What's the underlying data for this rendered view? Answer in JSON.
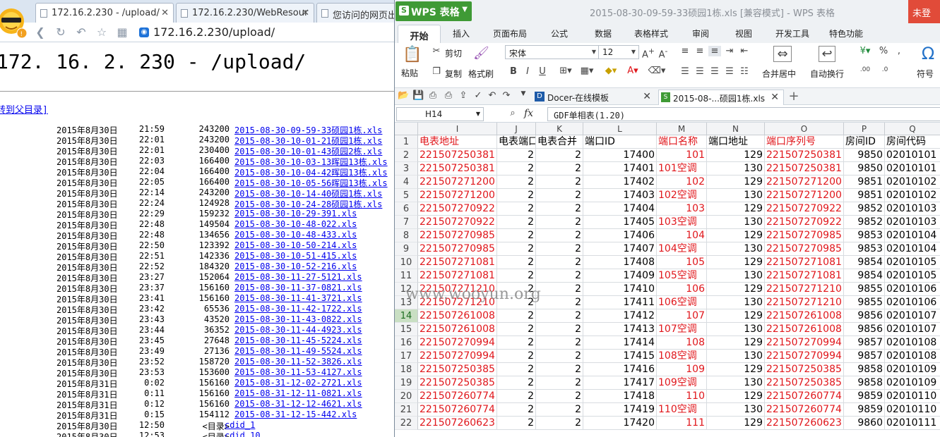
{
  "browser": {
    "tabs": [
      {
        "label": "172.16.2.230 - /upload/",
        "close": "✕"
      },
      {
        "label": "172.16.2.230/WebResour",
        "close": "✕"
      },
      {
        "label": "您访问的网页出"
      }
    ],
    "url": "172.16.2.230/upload/",
    "page_title": "172. 16. 2. 230 - /upload/",
    "parent_link": "转到父目录]",
    "files": [
      {
        "date": "2015年8月30日",
        "time": "21:59",
        "size": "243200",
        "name": "2015-08-30-09-59-33硕园1栋.xls"
      },
      {
        "date": "2015年8月30日",
        "time": "22:01",
        "size": "243200",
        "name": "2015-08-30-10-01-21硕园1栋.xls"
      },
      {
        "date": "2015年8月30日",
        "time": "22:01",
        "size": "230400",
        "name": "2015-08-30-10-01-43硕园2栋.xls"
      },
      {
        "date": "2015年8月30日",
        "time": "22:03",
        "size": "166400",
        "name": "2015-08-30-10-03-13晖园13栋.xls"
      },
      {
        "date": "2015年8月30日",
        "time": "22:04",
        "size": "166400",
        "name": "2015-08-30-10-04-42晖园13栋.xls"
      },
      {
        "date": "2015年8月30日",
        "time": "22:05",
        "size": "166400",
        "name": "2015-08-30-10-05-56晖园13栋.xls"
      },
      {
        "date": "2015年8月30日",
        "time": "22:14",
        "size": "243200",
        "name": "2015-08-30-10-14-40硕园1栋.xls"
      },
      {
        "date": "2015年8月30日",
        "time": "22:24",
        "size": "124928",
        "name": "2015-08-30-10-24-28硕园1栋.xls"
      },
      {
        "date": "2015年8月30日",
        "time": "22:29",
        "size": "159232",
        "name": "2015-08-30-10-29-391.xls"
      },
      {
        "date": "2015年8月30日",
        "time": "22:48",
        "size": "149504",
        "name": "2015-08-30-10-48-022.xls"
      },
      {
        "date": "2015年8月30日",
        "time": "22:48",
        "size": "134656",
        "name": "2015-08-30-10-48-433.xls"
      },
      {
        "date": "2015年8月30日",
        "time": "22:50",
        "size": "123392",
        "name": "2015-08-30-10-50-214.xls"
      },
      {
        "date": "2015年8月30日",
        "time": "22:51",
        "size": "142336",
        "name": "2015-08-30-10-51-415.xls"
      },
      {
        "date": "2015年8月30日",
        "time": "22:52",
        "size": "184320",
        "name": "2015-08-30-10-52-216.xls"
      },
      {
        "date": "2015年8月30日",
        "time": "23:27",
        "size": "152064",
        "name": "2015-08-30-11-27-5121.xls"
      },
      {
        "date": "2015年8月30日",
        "time": "23:37",
        "size": "156160",
        "name": "2015-08-30-11-37-0821.xls"
      },
      {
        "date": "2015年8月30日",
        "time": "23:41",
        "size": "156160",
        "name": "2015-08-30-11-41-3721.xls"
      },
      {
        "date": "2015年8月30日",
        "time": "23:42",
        "size": "65536",
        "name": "2015-08-30-11-42-1722.xls"
      },
      {
        "date": "2015年8月30日",
        "time": "23:43",
        "size": "43520",
        "name": "2015-08-30-11-43-0822.xls"
      },
      {
        "date": "2015年8月30日",
        "time": "23:44",
        "size": "36352",
        "name": "2015-08-30-11-44-4923.xls"
      },
      {
        "date": "2015年8月30日",
        "time": "23:45",
        "size": "27648",
        "name": "2015-08-30-11-45-5224.xls"
      },
      {
        "date": "2015年8月30日",
        "time": "23:49",
        "size": "27136",
        "name": "2015-08-30-11-49-5524.xls"
      },
      {
        "date": "2015年8月30日",
        "time": "23:52",
        "size": "158720",
        "name": "2015-08-30-11-52-3826.xls"
      },
      {
        "date": "2015年8月30日",
        "time": "23:53",
        "size": "153600",
        "name": "2015-08-30-11-53-4127.xls"
      },
      {
        "date": "2015年8月31日",
        "time": "0:02",
        "size": "156160",
        "name": "2015-08-31-12-02-2721.xls"
      },
      {
        "date": "2015年8月31日",
        "time": "0:11",
        "size": "156160",
        "name": "2015-08-31-12-11-0821.xls"
      },
      {
        "date": "2015年8月31日",
        "time": "0:12",
        "size": "156160",
        "name": "2015-08-31-12-12-4621.xls"
      },
      {
        "date": "2015年8月31日",
        "time": "0:15",
        "size": "154112",
        "name": "2015-08-31-12-15-442.xls"
      },
      {
        "date": "2015年8月30日",
        "time": "12:50",
        "size": "<目录>",
        "name": "cdid_1",
        "dir": true
      },
      {
        "date": "2015年8月30日",
        "time": "12:53",
        "size": "<目录>",
        "name": "cdid_10",
        "dir": true
      }
    ]
  },
  "wps": {
    "app_button": "WPS 表格",
    "doc_title": "2015-08-30-09-59-33硕园1栋.xls [兼容模式] - WPS 表格",
    "login": "未登",
    "menus": [
      "开始",
      "插入",
      "页面布局",
      "公式",
      "数据",
      "表格样式",
      "审阅",
      "视图",
      "开发工具",
      "特色功能"
    ],
    "ribbon": {
      "paste": "粘贴",
      "cut": "剪切",
      "copy": "复制",
      "format_painter": "格式刷",
      "font": "宋体",
      "font_size": "12",
      "merge_center": "合并居中",
      "auto_wrap": "自动换行",
      "symbol": "符号",
      "bold": "B",
      "italic": "I",
      "underline": "U"
    },
    "doc_tabs": [
      {
        "label": "Docer-在线模板",
        "close": "✕"
      },
      {
        "label": "2015-08-...硕园1栋.xls",
        "close": "✕"
      }
    ],
    "name_box": "H14",
    "fx": "fx",
    "formula": "GDF单相表(1.20)",
    "columns": [
      "I",
      "J",
      "K",
      "L",
      "M",
      "N",
      "O",
      "P",
      "Q"
    ],
    "row_numbers": [
      "1",
      "2",
      "3",
      "4",
      "5",
      "6",
      "7",
      "8",
      "9",
      "10",
      "11",
      "12",
      "13",
      "14",
      "15",
      "16",
      "17",
      "18",
      "19",
      "20",
      "21",
      "22"
    ],
    "selected_row": "14",
    "header_row": [
      "电表地址",
      "电表端口",
      "电表合并",
      "端口ID",
      "端口名称",
      "端口地址",
      "端口序列号",
      "房间ID",
      "房间代码"
    ],
    "rows": [
      [
        "221507250381",
        "2",
        "2",
        "17400",
        "101",
        "129",
        "221507250381",
        "9850",
        "02010101"
      ],
      [
        "221507250381",
        "2",
        "2",
        "17401",
        "101空调",
        "130",
        "221507250381",
        "9850",
        "02010101"
      ],
      [
        "221507271200",
        "2",
        "2",
        "17402",
        "102",
        "129",
        "221507271200",
        "9851",
        "02010102"
      ],
      [
        "221507271200",
        "2",
        "2",
        "17403",
        "102空调",
        "130",
        "221507271200",
        "9851",
        "02010102"
      ],
      [
        "221507270922",
        "2",
        "2",
        "17404",
        "103",
        "129",
        "221507270922",
        "9852",
        "02010103"
      ],
      [
        "221507270922",
        "2",
        "2",
        "17405",
        "103空调",
        "130",
        "221507270922",
        "9852",
        "02010103"
      ],
      [
        "221507270985",
        "2",
        "2",
        "17406",
        "104",
        "129",
        "221507270985",
        "9853",
        "02010104"
      ],
      [
        "221507270985",
        "2",
        "2",
        "17407",
        "104空调",
        "130",
        "221507270985",
        "9853",
        "02010104"
      ],
      [
        "221507271081",
        "2",
        "2",
        "17408",
        "105",
        "129",
        "221507271081",
        "9854",
        "02010105"
      ],
      [
        "221507271081",
        "2",
        "2",
        "17409",
        "105空调",
        "130",
        "221507271081",
        "9854",
        "02010105"
      ],
      [
        "221507271210",
        "2",
        "2",
        "17410",
        "106",
        "129",
        "221507271210",
        "9855",
        "02010106"
      ],
      [
        "221507271210",
        "2",
        "2",
        "17411",
        "106空调",
        "130",
        "221507271210",
        "9855",
        "02010106"
      ],
      [
        "221507261008",
        "2",
        "2",
        "17412",
        "107",
        "129",
        "221507261008",
        "9856",
        "02010107"
      ],
      [
        "221507261008",
        "2",
        "2",
        "17413",
        "107空调",
        "130",
        "221507261008",
        "9856",
        "02010107"
      ],
      [
        "221507270994",
        "2",
        "2",
        "17414",
        "108",
        "129",
        "221507270994",
        "9857",
        "02010108"
      ],
      [
        "221507270994",
        "2",
        "2",
        "17415",
        "108空调",
        "130",
        "221507270994",
        "9857",
        "02010108"
      ],
      [
        "221507250385",
        "2",
        "2",
        "17416",
        "109",
        "129",
        "221507250385",
        "9858",
        "02010109"
      ],
      [
        "221507250385",
        "2",
        "2",
        "17417",
        "109空调",
        "130",
        "221507250385",
        "9858",
        "02010109"
      ],
      [
        "221507260774",
        "2",
        "2",
        "17418",
        "110",
        "129",
        "221507260774",
        "9859",
        "02010110"
      ],
      [
        "221507260774",
        "2",
        "2",
        "17419",
        "110空调",
        "130",
        "221507260774",
        "9859",
        "02010110"
      ],
      [
        "221507260623",
        "2",
        "2",
        "17420",
        "111",
        "129",
        "221507260623",
        "9860",
        "02010111"
      ]
    ]
  },
  "watermark": "www.wooyun.org",
  "colors": {
    "link": "#0000ee",
    "red_text": "#e0161b",
    "wps_green": "#3f9a35",
    "login_red": "#e14b39"
  }
}
